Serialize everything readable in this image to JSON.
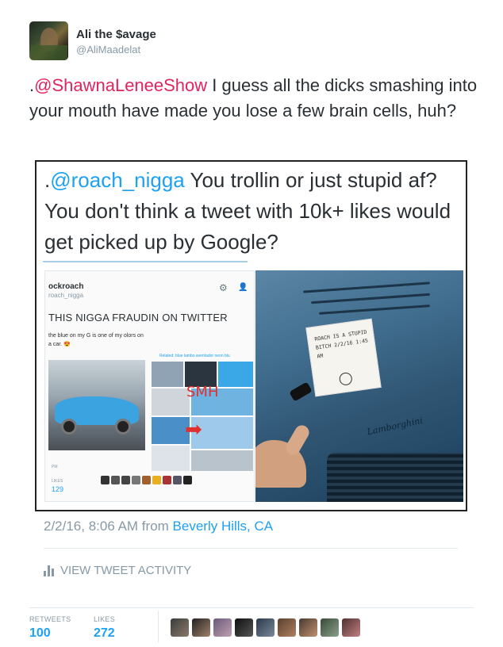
{
  "tweet": {
    "display_name": "Ali the $avage",
    "handle": "@AliMaadelat",
    "text_prefix": ".",
    "mention": "@ShawnaLeneeShow",
    "text_body": " I guess all the dicks smashing into your mouth have made you lose a few brain cells, huh?",
    "timestamp": "2/2/16, 8:06 AM from ",
    "location": "Beverly Hills, CA",
    "activity_label": "VIEW TWEET ACTIVITY",
    "stats": {
      "retweets_label": "RETWEETS",
      "retweets": "100",
      "likes_label": "LIKES",
      "likes": "272"
    }
  },
  "media": {
    "quoted_prefix": ".",
    "quoted_mention": "@roach_nigga",
    "quoted_body": " You trollin or just stupid af? You don't think a tweet with 10k+ likes would get picked up by Google?",
    "screenshot": {
      "name": "ockroach",
      "handle": "roach_nigga",
      "title": "THIS NIGGA FRAUDIN ON TWITTER",
      "left_text": "the blue on my G is one of my olors on a car. 😍",
      "related": "Related:  blue lambo  aventador    neon blu",
      "smh": "SMH",
      "pm": "PM",
      "likes_label": "LIKES",
      "likes": "129"
    },
    "photo": {
      "note": "ROACH IS A STUPID BITCH 2/2/16  1:45 AM",
      "logo": "Lamborghini"
    }
  },
  "colors": {
    "mention": "#e0245e",
    "link": "#1da1f2",
    "muted": "#8899a6",
    "text": "#292f33"
  }
}
